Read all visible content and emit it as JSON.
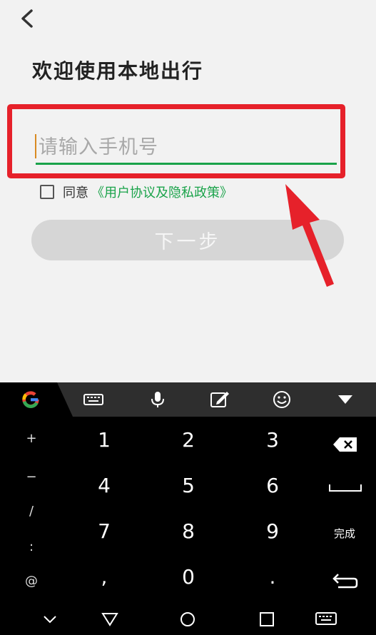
{
  "header": {
    "title": "欢迎使用本地出行"
  },
  "login": {
    "phone_placeholder": "请输入手机号",
    "agree_prefix": "同意",
    "agreement_link": "《用户协议及隐私政策》",
    "next_label": "下一步"
  },
  "keyboard": {
    "symbols": [
      "+",
      "−",
      "/",
      ":",
      "@"
    ],
    "rows": [
      [
        "1",
        "2",
        "3"
      ],
      [
        "4",
        "5",
        "6"
      ],
      [
        "7",
        "8",
        "9"
      ],
      [
        ",",
        "0",
        "."
      ]
    ],
    "done_label": "完成",
    "toolbar_icons": [
      "google-g-icon",
      "keyboard-icon",
      "mic-icon",
      "edit-icon",
      "emoji-icon",
      "collapse-icon"
    ]
  },
  "colors": {
    "accent_green": "#1aa34a",
    "highlight_red": "#e6212a",
    "caret_orange": "#d98a22"
  }
}
